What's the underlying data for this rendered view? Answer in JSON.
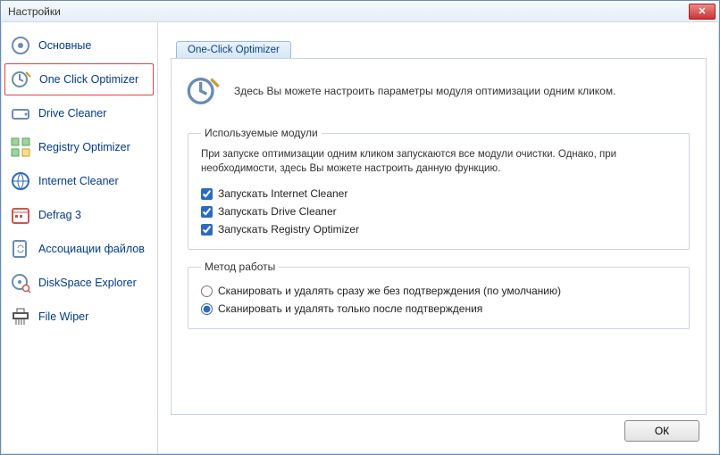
{
  "window": {
    "title": "Настройки"
  },
  "sidebar": {
    "items": [
      {
        "label": "Основные",
        "icon": "settings"
      },
      {
        "label": "One Click Optimizer",
        "icon": "cursor-wand",
        "selected": true
      },
      {
        "label": "Drive Cleaner",
        "icon": "drive"
      },
      {
        "label": "Registry Optimizer",
        "icon": "registry"
      },
      {
        "label": "Internet Cleaner",
        "icon": "globe"
      },
      {
        "label": "Defrag 3",
        "icon": "calendar"
      },
      {
        "label": "Ассоциации файлов",
        "icon": "link"
      },
      {
        "label": "DiskSpace Explorer",
        "icon": "disk-search"
      },
      {
        "label": "File Wiper",
        "icon": "shredder"
      }
    ]
  },
  "tab": {
    "label": "One-Click Optimizer"
  },
  "intro": {
    "text": "Здесь Вы можете настроить параметры модуля оптимизации одним кликом."
  },
  "modules": {
    "legend": "Используемые модули",
    "hint": "При запуске оптимизации одним кликом запускаются все модули очистки. Однако, при необходимости, здесь Вы можете настроить данную функцию.",
    "options": [
      {
        "label": "Запускать Internet Cleaner",
        "checked": true
      },
      {
        "label": "Запускать Drive Cleaner",
        "checked": true
      },
      {
        "label": "Запускать Registry Optimizer",
        "checked": true
      }
    ]
  },
  "method": {
    "legend": "Метод работы",
    "options": [
      {
        "label": "Сканировать и удалять сразу же без подтверждения (по умолчанию)",
        "selected": false
      },
      {
        "label": "Сканировать и удалять только после подтверждения",
        "selected": true
      }
    ]
  },
  "buttons": {
    "ok": "ОК"
  },
  "icons": {
    "settings": "<svg viewBox='0 0 24 24' width='24' height='24'><circle cx='12' cy='12' r='9' fill='none' stroke='#6a8bb6' stroke-width='2'/><circle cx='12' cy='12' r='3' fill='#6a8bb6'/></svg>",
    "cursor-wand": "<svg viewBox='0 0 24 24' width='24' height='24'><circle cx='10' cy='12' r='8' fill='none' stroke='#6a8bb6' stroke-width='2'/><path d='M10 6 L10 12 L14 14' stroke='#6a8bb6' stroke-width='2' fill='none'/><path d='M17 4 L22 9' stroke='#c79b2e' stroke-width='2'/></svg>",
    "drive": "<svg viewBox='0 0 24 24' width='24' height='24'><rect x='3' y='8' width='18' height='10' rx='2' fill='none' stroke='#6a8bb6' stroke-width='2'/><circle cx='18' cy='13' r='1.5' fill='#6a8bb6'/></svg>",
    "registry": "<svg viewBox='0 0 24 24' width='24' height='24'><rect x='2' y='2' width='8' height='8' fill='#9fd39f' stroke='#5aa65a'/><rect x='14' y='2' width='8' height='8' fill='#9fd39f' stroke='#5aa65a'/><rect x='2' y='14' width='8' height='8' fill='#9fd39f' stroke='#5aa65a'/><rect x='14' y='14' width='8' height='8' fill='#ffe08a' stroke='#c79b2e'/></svg>",
    "globe": "<svg viewBox='0 0 24 24' width='24' height='24'><circle cx='12' cy='12' r='9' fill='none' stroke='#2a6ac2' stroke-width='2'/><path d='M3 12 H21 M12 3 C8 8 8 16 12 21 M12 3 C16 8 16 16 12 21' stroke='#2a6ac2' fill='none'/></svg>",
    "calendar": "<svg viewBox='0 0 24 24' width='24' height='24'><rect x='3' y='5' width='18' height='16' rx='2' fill='none' stroke='#c55' stroke-width='2'/><line x1='3' y1='9' x2='21' y2='9' stroke='#c55'/><rect x='6' y='12' width='3' height='3' fill='#c55'/><rect x='11' y='12' width='3' height='3' fill='#c55'/></svg>",
    "link": "<svg viewBox='0 0 24 24' width='24' height='24'><rect x='4' y='3' width='14' height='18' rx='2' fill='none' stroke='#6a8bb6' stroke-width='2'/><path d='M9 11 a3 3 0 0 1 6 0 M9 13 a3 3 0 0 0 6 0' stroke='#6a8bb6' fill='none'/></svg>",
    "disk-search": "<svg viewBox='0 0 24 24' width='24' height='24'><circle cx='11' cy='11' r='8' fill='none' stroke='#6a8bb6' stroke-width='2'/><circle cx='11' cy='11' r='2' fill='#6a8bb6'/><circle cx='18' cy='18' r='3.5' fill='#fff' stroke='#c55' stroke-width='1.5'/><line x1='20.5' y1='20.5' x2='23' y2='23' stroke='#c55' stroke-width='1.5'/></svg>",
    "shredder": "<svg viewBox='0 0 24 24' width='24' height='24'><rect x='4' y='8' width='16' height='6' fill='none' stroke='#555' stroke-width='2'/><line x1='7' y1='14' x2='7' y2='21' stroke='#555'/><line x1='10' y1='14' x2='10' y2='21' stroke='#555'/><line x1='13' y1='14' x2='13' y2='21' stroke='#555'/><line x1='16' y1='14' x2='16' y2='21' stroke='#555'/><path d='M8 8 L8 3 L16 3 L16 8' fill='none' stroke='#555'/></svg>",
    "close-x": "✕"
  }
}
